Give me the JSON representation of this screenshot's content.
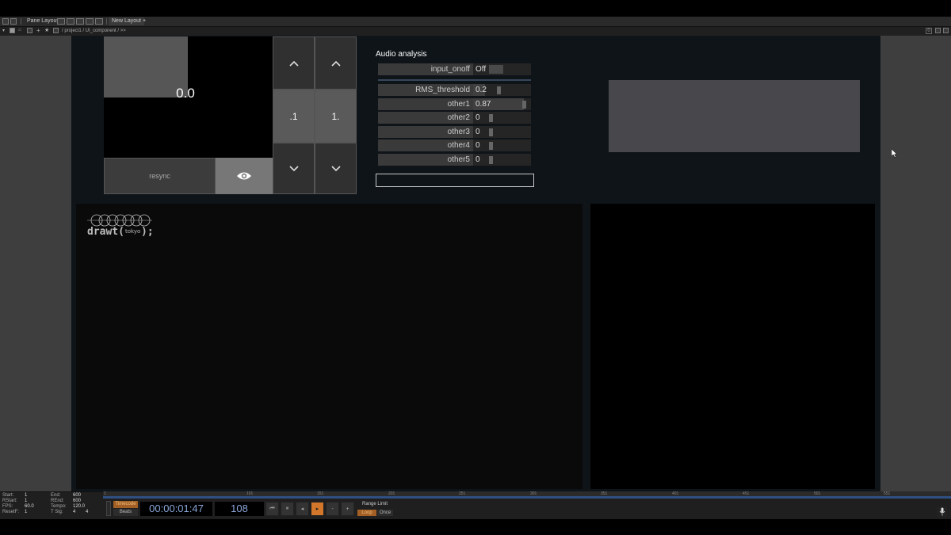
{
  "tabbar": {
    "pane_layout": "Pane Layout",
    "new_layout": "New Layout"
  },
  "pathbar": {
    "path": "/ project1 / UI_component / >>",
    "right_value": "0"
  },
  "preview": {
    "value": "0.0",
    "resync_label": "resync"
  },
  "grid": {
    "left_mid_label": ".1",
    "right_mid_label": "1."
  },
  "audio": {
    "title": "Audio analysis",
    "input_onoff": {
      "label": "input_onoff",
      "value": "Off"
    },
    "params": [
      {
        "label": "RMS_threshold",
        "value": "0.2",
        "level": 0.2
      },
      {
        "label": "other1",
        "value": "0.87",
        "level": 0.87
      },
      {
        "label": "other2",
        "value": "0",
        "level": 0
      },
      {
        "label": "other3",
        "value": "0",
        "level": 0
      },
      {
        "label": "other4",
        "value": "0",
        "level": 0
      },
      {
        "label": "other5",
        "value": "0",
        "level": 0
      }
    ]
  },
  "logo": {
    "text": "drawt(tokyo);"
  },
  "timeline": {
    "info": {
      "start_label": "Start:",
      "start": "1",
      "rstart_label": "RStart:",
      "rstart": "1",
      "fps_label": "FPS:",
      "fps": "60.0",
      "resetf_label": "ResetF:",
      "resetf": "1",
      "end_label": "End:",
      "end": "600",
      "rend_label": "REnd:",
      "rend": "600",
      "tempo_label": "Tempo:",
      "tempo": "120.0",
      "tsig_label": "T Sig:",
      "tsig_a": "4",
      "tsig_b": "4"
    },
    "ticks": [
      "1",
      "101",
      "151",
      "201",
      "251",
      "301",
      "351",
      "401",
      "451",
      "501",
      "551"
    ],
    "timecode_label": "Timecode",
    "beats_label": "Beats",
    "timecode": "00:00:01:47",
    "frame": "108",
    "range_limit": "Range Limit",
    "loop": "Loop",
    "once": "Once"
  }
}
